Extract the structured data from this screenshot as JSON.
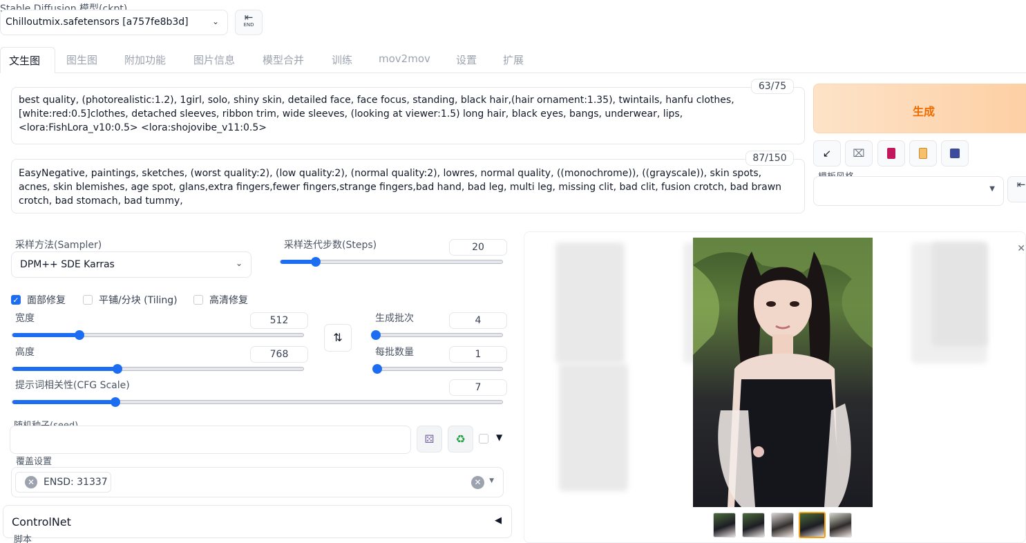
{
  "model": {
    "label": "Stable Diffusion 模型(ckpt)",
    "value": "Chilloutmix.safetensors [a757fe8b3d]",
    "end_icon": "end-arrow-icon"
  },
  "tabs": [
    {
      "label": "文生图",
      "active": true
    },
    {
      "label": "图生图"
    },
    {
      "label": "附加功能"
    },
    {
      "label": "图片信息"
    },
    {
      "label": "模型合并"
    },
    {
      "label": "训练"
    },
    {
      "label": "mov2mov"
    },
    {
      "label": "设置"
    },
    {
      "label": "扩展"
    }
  ],
  "prompt": {
    "text": "best quality, (photorealistic:1.2), 1girl, solo, shiny skin, detailed face, face focus, standing, black hair,(hair ornament:1.35), twintails, hanfu clothes, [white:red:0.5]clothes, detached sleeves, ribbon trim, wide sleeves, (looking at viewer:1.5) long hair,  black eyes, bangs, underwear, lips, <lora:FishLora_v10:0.5> <lora:shojovibe_v11:0.5>",
    "token_count": "63/75"
  },
  "negative_prompt": {
    "text": "EasyNegative, paintings, sketches, (worst quality:2), (low quality:2), (normal quality:2), lowres, normal quality, ((monochrome)), ((grayscale)), skin spots, acnes, skin blemishes, age spot, glans,extra fingers,fewer fingers,strange fingers,bad hand, bad leg, multi leg, missing clit, bad clit, fusion crotch, bad brawn crotch, bad stomach, bad tummy,",
    "token_count": "87/150"
  },
  "generate_button": "生成",
  "tools": [
    {
      "icon": "arrow-down-left-icon",
      "glyph": "↙"
    },
    {
      "icon": "trash-icon",
      "glyph": "🗑"
    },
    {
      "icon": "red-book-icon",
      "glyph": "▮"
    },
    {
      "icon": "clipboard-icon",
      "glyph": "📋"
    },
    {
      "icon": "save-icon",
      "glyph": "💾"
    }
  ],
  "style": {
    "label": "模板风格"
  },
  "sampler": {
    "label": "采样方法(Sampler)",
    "value": "DPM++ SDE Karras"
  },
  "steps": {
    "label": "采样迭代步数(Steps)",
    "value": "20",
    "fraction": 0.16
  },
  "checkboxes": [
    {
      "label": "面部修复",
      "checked": true
    },
    {
      "label": "平铺/分块 (Tiling)",
      "checked": false
    },
    {
      "label": "高清修复",
      "checked": false
    }
  ],
  "width": {
    "label": "宽度",
    "value": "512",
    "fraction": 0.23
  },
  "height": {
    "label": "高度",
    "value": "768",
    "fraction": 0.36
  },
  "batch_count": {
    "label": "生成批次",
    "value": "4",
    "fraction": 0.02
  },
  "batch_size": {
    "label": "每批数量",
    "value": "1",
    "fraction": 0.0
  },
  "cfg": {
    "label": "提示词相关性(CFG Scale)",
    "value": "7",
    "fraction": 0.21
  },
  "seed": {
    "label": "随机种子(seed)",
    "value": ""
  },
  "override": {
    "label": "覆盖设置",
    "chip": "ENSD: 31337"
  },
  "controlnet": {
    "label": "ControlNet"
  },
  "script": {
    "label": "脚本"
  },
  "colors": {
    "accent": "#1d6df2",
    "generate_text": "#ef6c00",
    "generate_bg": "#fdd9b5"
  }
}
